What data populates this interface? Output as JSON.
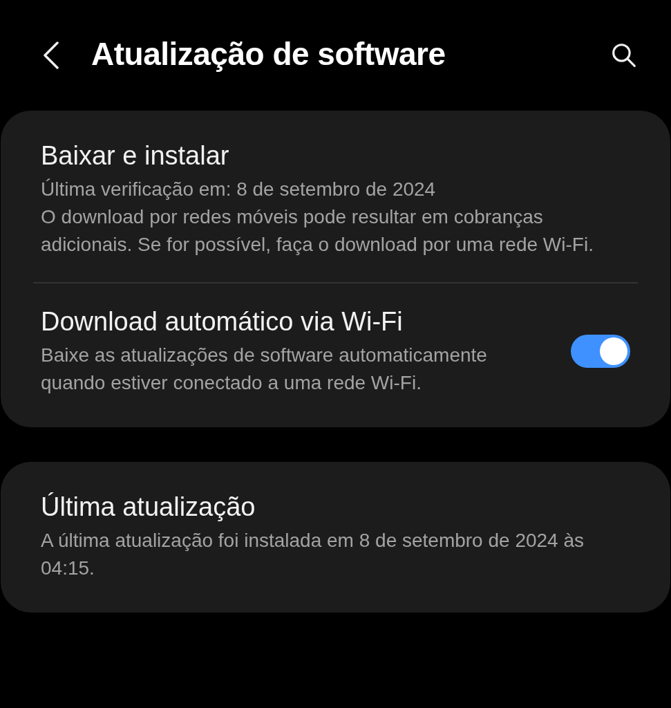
{
  "header": {
    "title": "Atualização de software"
  },
  "cards": [
    {
      "items": [
        {
          "kind": "text",
          "title": "Baixar e instalar",
          "lines": [
            "Última verificação em: 8 de setembro de 2024",
            "O download por redes móveis pode resultar em cobranças adicionais. Se for possível, faça o download por uma rede Wi-Fi."
          ]
        },
        {
          "kind": "toggle",
          "title": "Download automático via Wi-Fi",
          "lines": [
            "Baixe as atualizações de software automaticamente quando estiver conectado a uma rede Wi-Fi."
          ],
          "on": true
        }
      ]
    },
    {
      "items": [
        {
          "kind": "text",
          "title": "Última atualização",
          "lines": [
            "A última atualização foi instalada em 8 de setembro de 2024 às 04:15."
          ]
        }
      ]
    }
  ]
}
